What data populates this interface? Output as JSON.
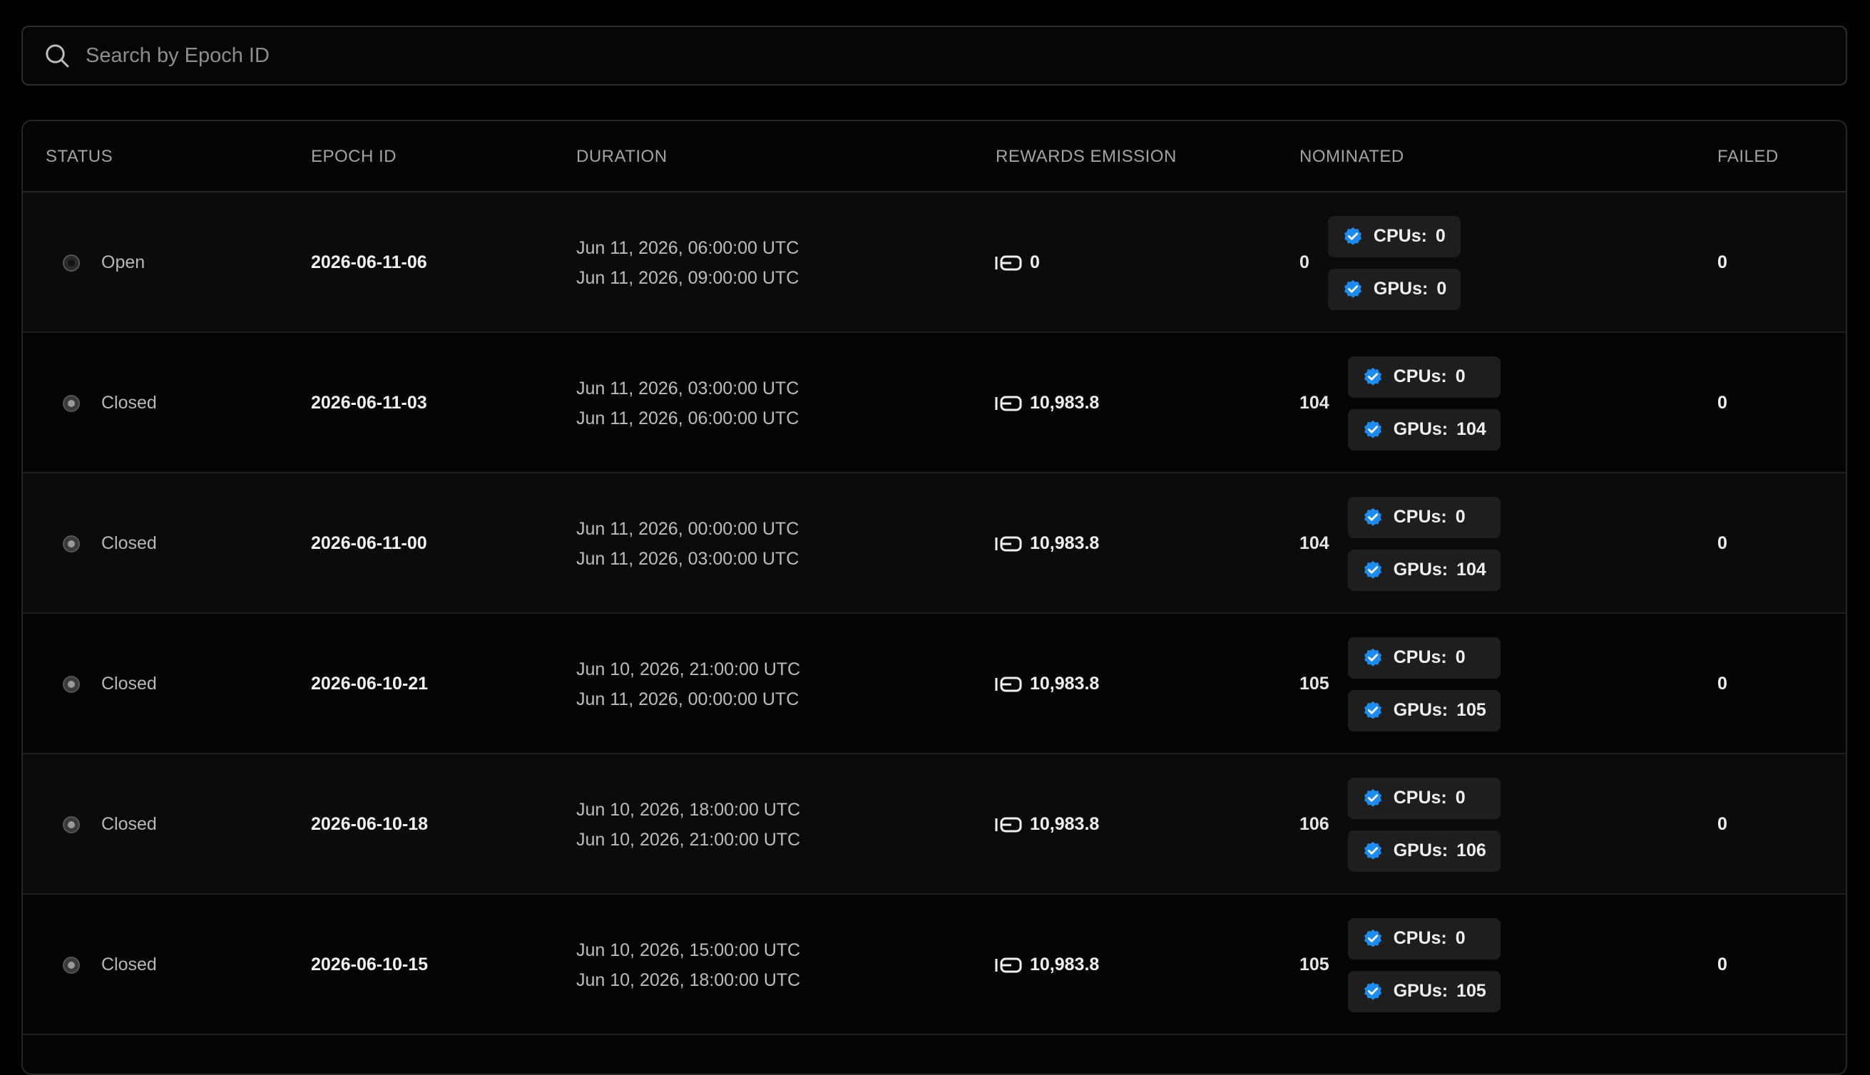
{
  "search": {
    "placeholder": "Search by Epoch ID"
  },
  "columns": {
    "status": "STATUS",
    "epoch_id": "EPOCH ID",
    "duration": "DURATION",
    "rewards": "REWARDS EMISSION",
    "nominated": "NOMINATED",
    "failed": "FAILED"
  },
  "labels": {
    "cpus": "CPUs:",
    "gpus": "GPUs:"
  },
  "colors": {
    "background": "#000000",
    "verified_badge": "#1d8cf0"
  },
  "rows": [
    {
      "status": "Open",
      "epoch_id": "2026-06-11-06",
      "start": "Jun 11, 2026, 06:00:00 UTC",
      "end": "Jun 11, 2026, 09:00:00 UTC",
      "rewards": "0",
      "nominated": "0",
      "cpus": "0",
      "gpus": "0",
      "failed": "0"
    },
    {
      "status": "Closed",
      "epoch_id": "2026-06-11-03",
      "start": "Jun 11, 2026, 03:00:00 UTC",
      "end": "Jun 11, 2026, 06:00:00 UTC",
      "rewards": "10,983.8",
      "nominated": "104",
      "cpus": "0",
      "gpus": "104",
      "failed": "0"
    },
    {
      "status": "Closed",
      "epoch_id": "2026-06-11-00",
      "start": "Jun 11, 2026, 00:00:00 UTC",
      "end": "Jun 11, 2026, 03:00:00 UTC",
      "rewards": "10,983.8",
      "nominated": "104",
      "cpus": "0",
      "gpus": "104",
      "failed": "0"
    },
    {
      "status": "Closed",
      "epoch_id": "2026-06-10-21",
      "start": "Jun 10, 2026, 21:00:00 UTC",
      "end": "Jun 11, 2026, 00:00:00 UTC",
      "rewards": "10,983.8",
      "nominated": "105",
      "cpus": "0",
      "gpus": "105",
      "failed": "0"
    },
    {
      "status": "Closed",
      "epoch_id": "2026-06-10-18",
      "start": "Jun 10, 2026, 18:00:00 UTC",
      "end": "Jun 10, 2026, 21:00:00 UTC",
      "rewards": "10,983.8",
      "nominated": "106",
      "cpus": "0",
      "gpus": "106",
      "failed": "0"
    },
    {
      "status": "Closed",
      "epoch_id": "2026-06-10-15",
      "start": "Jun 10, 2026, 15:00:00 UTC",
      "end": "Jun 10, 2026, 18:00:00 UTC",
      "rewards": "10,983.8",
      "nominated": "105",
      "cpus": "0",
      "gpus": "105",
      "failed": "0"
    }
  ]
}
